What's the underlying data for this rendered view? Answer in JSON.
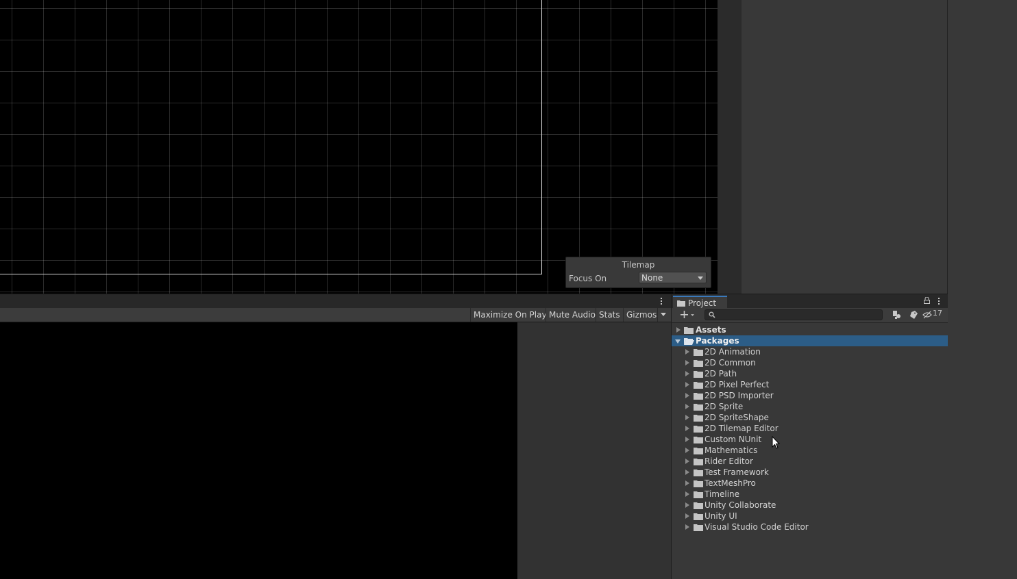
{
  "tilemap_overlay": {
    "title": "Tilemap",
    "focus_label": "Focus On",
    "focus_value": "None"
  },
  "game_toolbar": {
    "maximize_on_play": "Maximize On Play",
    "mute_audio": "Mute Audio",
    "stats": "Stats",
    "gizmos": "Gizmos"
  },
  "project": {
    "tab_label": "Project",
    "search_placeholder": "",
    "hidden_packages_count": "17",
    "root_items": [
      {
        "label": "Assets",
        "expanded": false,
        "selected": false
      },
      {
        "label": "Packages",
        "expanded": true,
        "selected": true
      }
    ],
    "packages": [
      "2D Animation",
      "2D Common",
      "2D Path",
      "2D Pixel Perfect",
      "2D PSD Importer",
      "2D Sprite",
      "2D SpriteShape",
      "2D Tilemap Editor",
      "Custom NUnit",
      "Mathematics",
      "Rider Editor",
      "Test Framework",
      "TextMeshPro",
      "Timeline",
      "Unity Collaborate",
      "Unity UI",
      "Visual Studio Code Editor"
    ]
  },
  "icons": {
    "tab_icon": "folder-icon",
    "lock": "lock-icon",
    "menu": "kebab-menu-icon",
    "create": "plus-icon",
    "search": "search-icon",
    "search_by_type": "search-by-type-icon",
    "search_by_label": "label-tag-icon",
    "hidden_packages": "eye-slash-icon"
  },
  "colors": {
    "selection": "#2c5d87",
    "tab_accent": "#3a79bb"
  }
}
